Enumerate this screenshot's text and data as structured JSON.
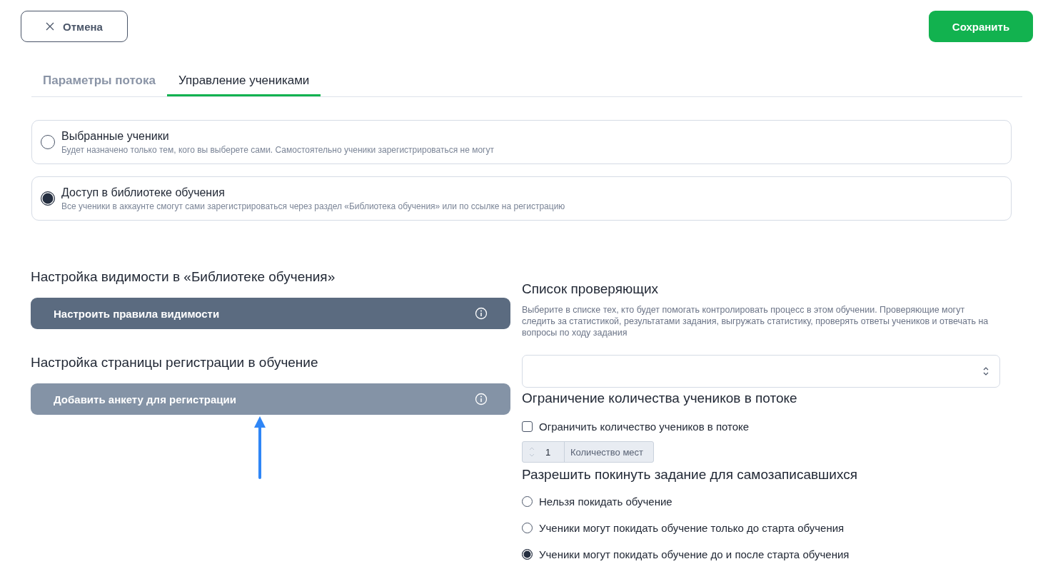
{
  "header": {
    "cancel_button": "Отмена",
    "save_button": "Сохранить"
  },
  "tabs": [
    {
      "label": "Параметры потока",
      "selected": false
    },
    {
      "label": "Управление учениками",
      "selected": true
    }
  ],
  "access_options": [
    {
      "title": "Выбранные ученики",
      "description": "Будет назначено только тем, кого вы выберете сами. Самостоятельно ученики зарегистрироваться не могут",
      "selected": false
    },
    {
      "title": "Доступ в библиотеке обучения",
      "description": "Все ученики в аккаунте смогут сами зарегистрироваться через раздел «Библиотека обучения» или по ссылке на регистрацию",
      "selected": true
    }
  ],
  "left_sections": [
    {
      "heading": "Настройка видимости в «Библиотеке обучения»",
      "button": "Настроить правила видимости",
      "disabled": false
    },
    {
      "heading": "Настройка страницы регистрации в обучение",
      "button": "Добавить анкету для регистрации",
      "disabled": true
    }
  ],
  "reviewers": {
    "heading": "Список проверяющих",
    "description": "Выберите в списке тех, кто будет помогать контролировать процесс в этом обучении. Проверяющие могут следить за статистикой, результатами задания, выгружать статистику, проверять ответы учеников и отвечать на вопросы по ходу задания"
  },
  "limit": {
    "heading": "Ограничение количества учеников в потоке",
    "checkbox_label": "Ограничить количество учеников в потоке",
    "checked": false,
    "value": "1",
    "unit": "Количество мест"
  },
  "leave": {
    "heading": "Разрешить покинуть задание для самозаписавшихся",
    "options": [
      {
        "label": "Нельзя покидать обучение",
        "selected": false
      },
      {
        "label": "Ученики могут покидать обучение только до старта обучения",
        "selected": false
      },
      {
        "label": "Ученики могут покидать обучение до и после старта обучения",
        "selected": true
      }
    ]
  }
}
